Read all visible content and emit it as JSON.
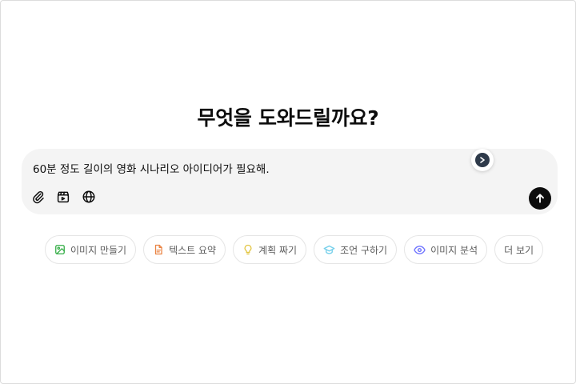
{
  "headline": "무엇을 도와드릴까요?",
  "composer": {
    "prompt_text": "60분 정도 길이의 영화 시나리오 아이디어가 필요해.",
    "icons": {
      "attach": "paperclip-icon",
      "tool": "clapperboard-icon",
      "web": "globe-icon",
      "send": "arrow-up-icon",
      "extension": "extension-badge-icon"
    }
  },
  "suggestions": [
    {
      "label": "이미지 만들기",
      "icon": "image-create-icon",
      "color": "#35ae47"
    },
    {
      "label": "텍스트 요약",
      "icon": "document-icon",
      "color": "#ea8444"
    },
    {
      "label": "계획 짜기",
      "icon": "lightbulb-icon",
      "color": "#e2c541"
    },
    {
      "label": "조언 구하기",
      "icon": "graduation-cap-icon",
      "color": "#76d0eb"
    },
    {
      "label": "이미지 분석",
      "icon": "eye-icon",
      "color": "#6c71ff"
    },
    {
      "label": "더 보기",
      "icon": "",
      "color": ""
    }
  ],
  "colors": {
    "background": "#ffffff",
    "composer_bg": "#f4f4f4",
    "text": "#0d0d0d",
    "chip_text": "#5d5d5d",
    "chip_border": "#e5e5e5",
    "send_bg": "#0d0d0d"
  }
}
